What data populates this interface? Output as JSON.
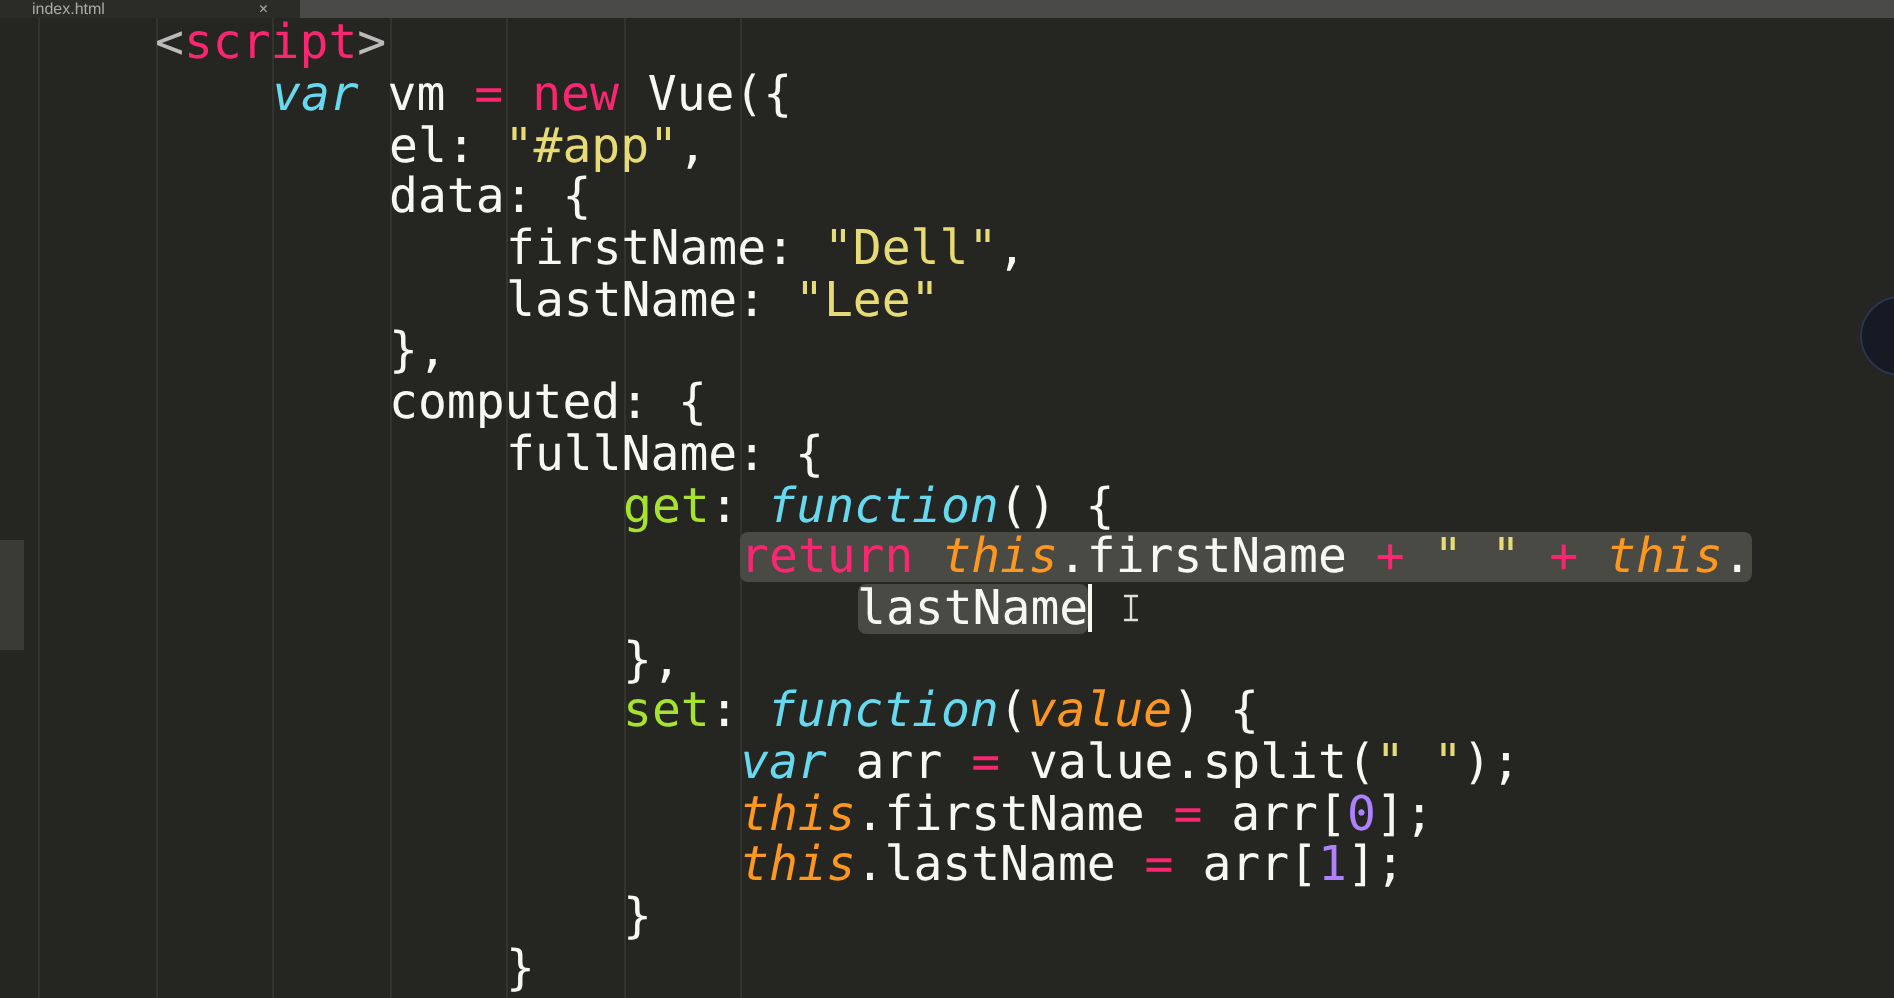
{
  "tab": {
    "label": "index.html",
    "close": "×"
  },
  "lines": [
    {
      "tokens": [
        {
          "text": "<",
          "kind": "punct"
        },
        {
          "text": "script",
          "kind": "tag"
        },
        {
          "text": ">",
          "kind": "punct"
        }
      ],
      "children": [
        {
          "tokens": [
            {
              "text": "var",
              "kind": "storage"
            },
            {
              "text": " vm ",
              "kind": "plain"
            },
            {
              "text": "= ",
              "kind": "keyword"
            },
            {
              "text": "new",
              "kind": "keyword"
            },
            {
              "text": " Vue({",
              "kind": "plain"
            }
          ],
          "children": [
            {
              "tokens": [
                {
                  "text": "el: ",
                  "kind": "plain"
                },
                {
                  "text": "\"#app\"",
                  "kind": "string"
                },
                {
                  "text": ",",
                  "kind": "plain"
                }
              ]
            },
            {
              "tokens": [
                {
                  "text": "data: {",
                  "kind": "plain"
                }
              ],
              "children": [
                {
                  "tokens": [
                    {
                      "text": "firstName: ",
                      "kind": "plain"
                    },
                    {
                      "text": "\"Dell\"",
                      "kind": "string"
                    },
                    {
                      "text": ",",
                      "kind": "plain"
                    }
                  ]
                },
                {
                  "tokens": [
                    {
                      "text": "lastName: ",
                      "kind": "plain"
                    },
                    {
                      "text": "\"Lee\"",
                      "kind": "string"
                    }
                  ]
                }
              ]
            },
            {
              "tokens": [
                {
                  "text": "},",
                  "kind": "plain"
                }
              ]
            },
            {
              "tokens": [
                {
                  "text": "computed: {",
                  "kind": "plain"
                }
              ],
              "children": [
                {
                  "tokens": [
                    {
                      "text": "fullName: {",
                      "kind": "plain"
                    }
                  ],
                  "children": [
                    {
                      "tokens": [
                        {
                          "text": "get",
                          "kind": "entity"
                        },
                        {
                          "text": ": ",
                          "kind": "plain"
                        },
                        {
                          "text": "function",
                          "kind": "storage"
                        },
                        {
                          "text": "() {",
                          "kind": "plain"
                        }
                      ],
                      "children": [
                        {
                          "selected": true,
                          "tokens": [
                            {
                              "text": "return ",
                              "kind": "keyword"
                            },
                            {
                              "text": "this",
                              "kind": "variable"
                            },
                            {
                              "text": ".firstName ",
                              "kind": "plain"
                            },
                            {
                              "text": "+ ",
                              "kind": "keyword"
                            },
                            {
                              "text": "\" \" ",
                              "kind": "string"
                            },
                            {
                              "text": "+ ",
                              "kind": "keyword"
                            },
                            {
                              "text": "this",
                              "kind": "variable"
                            },
                            {
                              "text": ".",
                              "kind": "plain"
                            }
                          ],
                          "children": [
                            {
                              "selected": true,
                              "cursor": true,
                              "tokens": [
                                {
                                  "text": "lastName",
                                  "kind": "plain"
                                }
                              ]
                            }
                          ]
                        }
                      ]
                    },
                    {
                      "tokens": [
                        {
                          "text": "},",
                          "kind": "plain"
                        }
                      ]
                    },
                    {
                      "tokens": [
                        {
                          "text": "set",
                          "kind": "entity"
                        },
                        {
                          "text": ": ",
                          "kind": "plain"
                        },
                        {
                          "text": "function",
                          "kind": "storage"
                        },
                        {
                          "text": "(",
                          "kind": "plain"
                        },
                        {
                          "text": "value",
                          "kind": "param"
                        },
                        {
                          "text": ") {",
                          "kind": "plain"
                        }
                      ],
                      "children": [
                        {
                          "tokens": [
                            {
                              "text": "var",
                              "kind": "storage"
                            },
                            {
                              "text": " arr ",
                              "kind": "plain"
                            },
                            {
                              "text": "=",
                              "kind": "keyword"
                            },
                            {
                              "text": " value.split(",
                              "kind": "plain"
                            },
                            {
                              "text": "\" \"",
                              "kind": "string"
                            },
                            {
                              "text": ");",
                              "kind": "plain"
                            }
                          ]
                        },
                        {
                          "tokens": [
                            {
                              "text": "this",
                              "kind": "variable"
                            },
                            {
                              "text": ".firstName ",
                              "kind": "plain"
                            },
                            {
                              "text": "=",
                              "kind": "keyword"
                            },
                            {
                              "text": " arr[",
                              "kind": "plain"
                            },
                            {
                              "text": "0",
                              "kind": "number"
                            },
                            {
                              "text": "];",
                              "kind": "plain"
                            }
                          ]
                        },
                        {
                          "tokens": [
                            {
                              "text": "this",
                              "kind": "variable"
                            },
                            {
                              "text": ".lastName ",
                              "kind": "plain"
                            },
                            {
                              "text": "=",
                              "kind": "keyword"
                            },
                            {
                              "text": " arr[",
                              "kind": "plain"
                            },
                            {
                              "text": "1",
                              "kind": "number"
                            },
                            {
                              "text": "];",
                              "kind": "plain"
                            }
                          ]
                        }
                      ]
                    },
                    {
                      "tokens": [
                        {
                          "text": "}",
                          "kind": "plain"
                        }
                      ]
                    }
                  ]
                },
                {
                  "tokens": [
                    {
                      "text": "}",
                      "kind": "plain"
                    }
                  ]
                }
              ]
            }
          ]
        }
      ]
    }
  ]
}
